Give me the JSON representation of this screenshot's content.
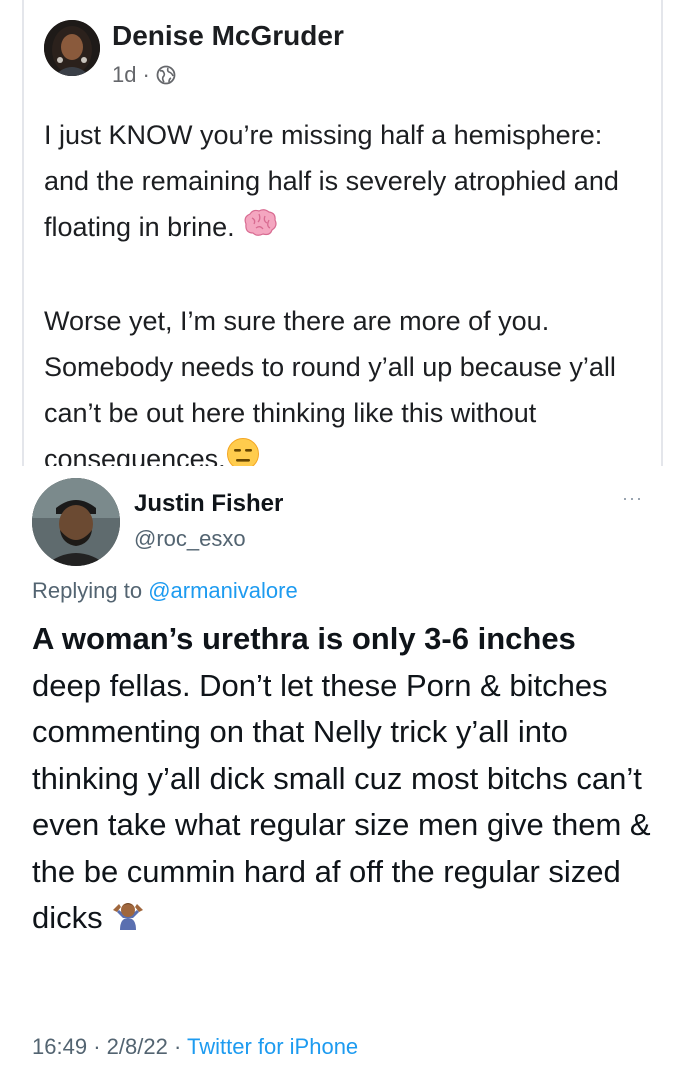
{
  "facebook_post": {
    "author": "Denise McGruder",
    "time": "1d",
    "separator": "·",
    "privacy_icon": "globe-icon",
    "paragraph1": "I just KNOW you’re missing half a hemisphere: and the remaining half is severely atrophied and floating in brine.",
    "paragraph1_emoji": "brain-emoji",
    "paragraph2": "Worse yet, I’m sure there are more of you. Somebody needs to round y’all up because y’all can’t be out here thinking like this without consequences.",
    "paragraph2_emoji": "expressionless-face-emoji"
  },
  "tweet": {
    "name": "Justin Fisher",
    "handle": "@roc_esxo",
    "more_label": "···",
    "replying_prefix": "Replying to",
    "replying_to": "@armanivalore",
    "bold_text": "A woman’s urethra is only 3-6 inches",
    "body_text": "deep fellas. Don’t let these Porn & bitches commenting on that Nelly trick y’all into thinking y’all dick small cuz most bitchs can’t even take what regular size men give them & the be cummin hard af off the regular sized dicks",
    "body_emoji": "person-shrugging-emoji",
    "time": "16:49",
    "date": "2/8/22",
    "separator": "·",
    "source": "Twitter for iPhone"
  }
}
